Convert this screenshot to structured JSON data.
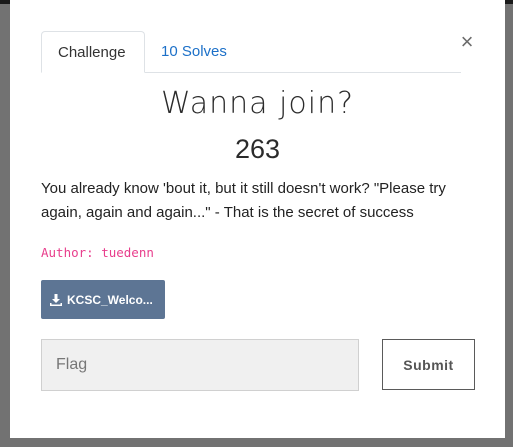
{
  "tabs": [
    {
      "label": "Challenge",
      "active": true
    },
    {
      "label": "10 Solves",
      "active": false
    }
  ],
  "close_icon": "×",
  "challenge": {
    "name": "Wanna join?",
    "points": "263",
    "description": "You already know 'bout it, but it still doesn't work? \"Please try again, again and again...\" - That is the secret of success",
    "author": "Author: tuedenn"
  },
  "file": {
    "label": "KCSC_Welco...",
    "icon": "download-icon"
  },
  "flag_input": {
    "placeholder": "Flag",
    "value": ""
  },
  "submit_label": "Submit",
  "colors": {
    "backdrop": "#727272",
    "tab_link": "#1c70c8",
    "author": "#e83e8c",
    "file_button": "#5d7594"
  }
}
